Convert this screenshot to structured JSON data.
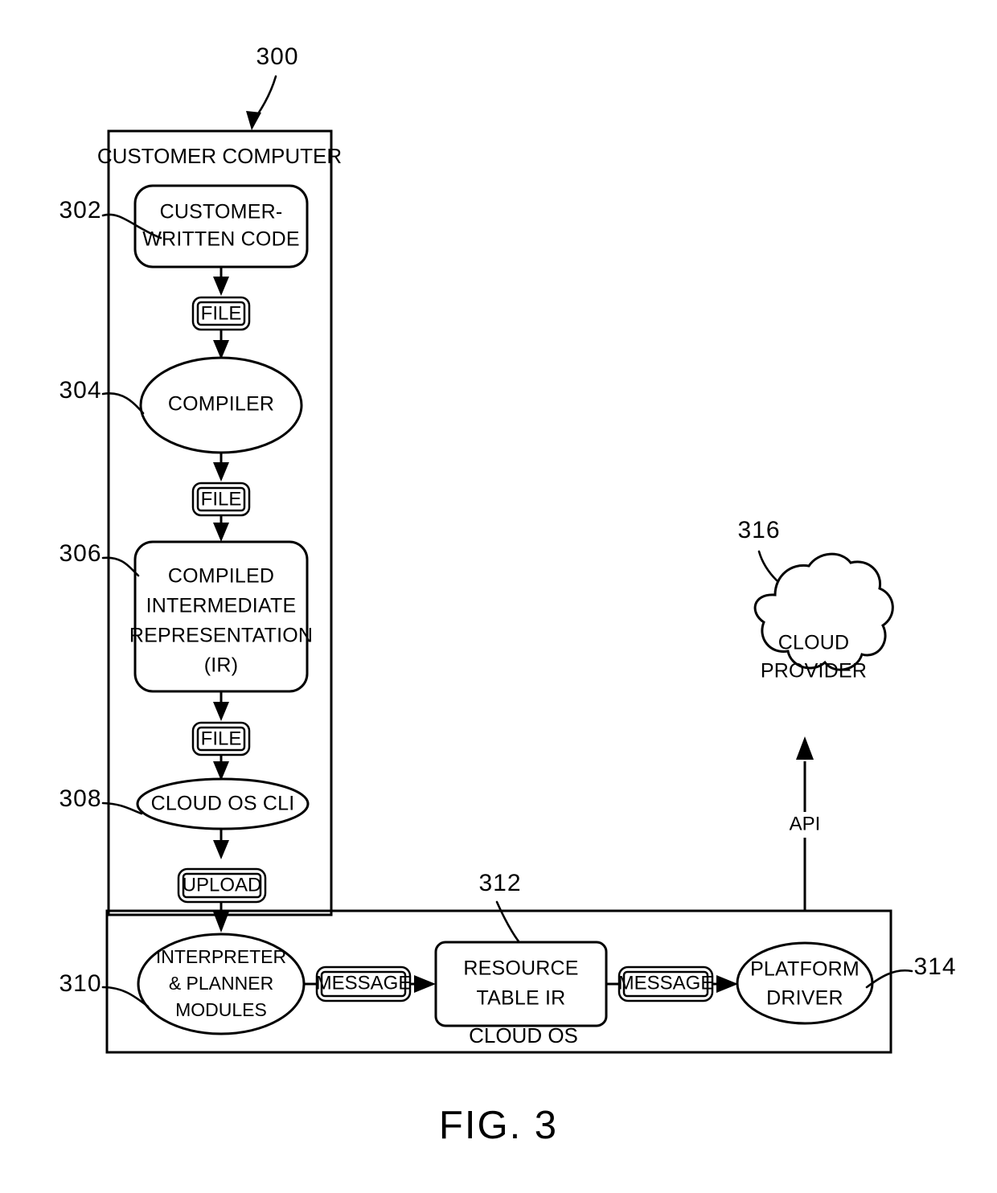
{
  "figure": {
    "caption": "FIG. 3",
    "overall_ref": "300"
  },
  "containers": [
    {
      "id": "customer-computer",
      "label": "CUSTOMER COMPUTER",
      "ref": "300"
    },
    {
      "id": "cloud-os",
      "label": "CLOUD OS",
      "ref": "312"
    }
  ],
  "nodes": {
    "customer_written_code": {
      "label_line1": "CUSTOMER-",
      "label_line2": "WRITTEN CODE",
      "ref": "302",
      "shape": "rounded-rect"
    },
    "compiler": {
      "label": "COMPILER",
      "ref": "304",
      "shape": "ellipse"
    },
    "compiled_ir": {
      "label_line1": "COMPILED",
      "label_line2": "INTERMEDIATE",
      "label_line3": "REPRESENTATION",
      "label_line4": "(IR)",
      "ref": "306",
      "shape": "rounded-rect"
    },
    "cloud_os_cli": {
      "label": "CLOUD OS CLI",
      "ref": "308",
      "shape": "ellipse"
    },
    "interpreter_planner": {
      "label_line1": "INTERPRETER",
      "label_line2": "& PLANNER",
      "label_line3": "MODULES",
      "ref": "310",
      "shape": "ellipse"
    },
    "resource_table_ir": {
      "label_line1": "RESOURCE",
      "label_line2": "TABLE IR",
      "ref": "312",
      "shape": "rounded-rect"
    },
    "platform_driver": {
      "label_line1": "PLATFORM",
      "label_line2": "DRIVER",
      "ref": "314",
      "shape": "ellipse"
    },
    "cloud_provider": {
      "label_line1": "CLOUD",
      "label_line2": "PROVIDER",
      "ref": "316",
      "shape": "cloud"
    }
  },
  "edge_chips": {
    "file_1": "FILE",
    "file_2": "FILE",
    "file_3": "FILE",
    "upload": "UPLOAD",
    "message_1": "MESSAGE",
    "message_2": "MESSAGE"
  },
  "edge_labels": {
    "api": "API"
  },
  "reference_numerals": [
    "300",
    "302",
    "304",
    "306",
    "308",
    "310",
    "312",
    "314",
    "316"
  ],
  "colors": {
    "stroke": "#000000",
    "fill": "#ffffff",
    "background": "#ffffff"
  }
}
